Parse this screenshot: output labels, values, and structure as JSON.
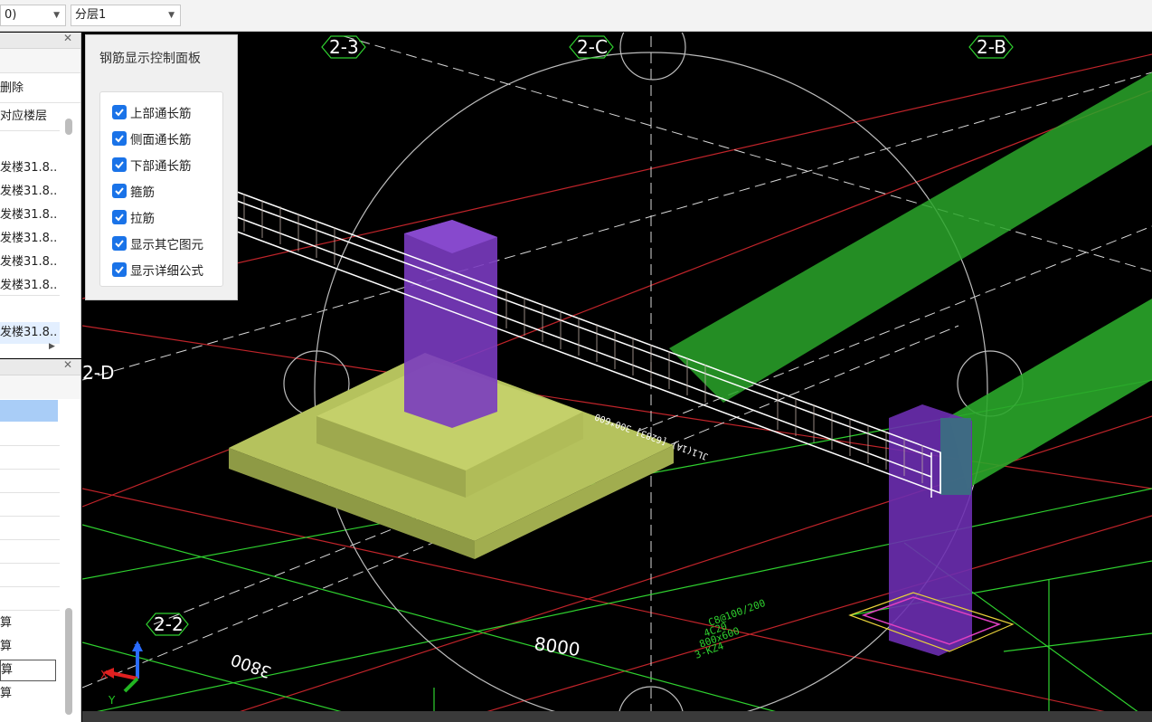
{
  "toolbar": {
    "combo1_value": "0)",
    "combo2_value": "分层1"
  },
  "left_panel_top": {
    "delete_label": "删除",
    "column_header": "对应楼层",
    "rows": [
      "发楼31.8..",
      "发楼31.8..",
      "发楼31.8..",
      "发楼31.8..",
      "发楼31.8..",
      "发楼31.8..",
      "发楼31.8.."
    ]
  },
  "left_panel_bottom": {
    "rows": [
      "算",
      "算",
      "算",
      "算"
    ]
  },
  "control_panel": {
    "title": "钢筋显示控制面板",
    "checkboxes": [
      {
        "label": "上部通长筋",
        "checked": true
      },
      {
        "label": "侧面通长筋",
        "checked": true
      },
      {
        "label": "下部通长筋",
        "checked": true
      },
      {
        "label": "箍筋",
        "checked": true
      },
      {
        "label": "拉筋",
        "checked": true
      },
      {
        "label": "显示其它图元",
        "checked": true
      },
      {
        "label": "显示详细公式",
        "checked": true
      }
    ]
  },
  "viewport": {
    "axis_labels": [
      "2-3",
      "2-C",
      "2-B",
      "2-D",
      "2-2"
    ],
    "dimensions": [
      "8000",
      "3800"
    ],
    "annotations": {
      "beam_text": "JL1(1A) [6283] 300*600",
      "column_text_1": "3-KZ4",
      "column_text_2": "800x600",
      "column_text_3": "4C20",
      "column_text_4": "C8@100/200"
    },
    "colors": {
      "background": "#000000",
      "grid_green": "#2fd12f",
      "grid_red": "#c0242a",
      "footing": "#b5c25d",
      "column": "#7a3bc0",
      "beam_green": "#2aa62a"
    },
    "gizmo_axes": [
      "X",
      "Y",
      "Z"
    ]
  }
}
